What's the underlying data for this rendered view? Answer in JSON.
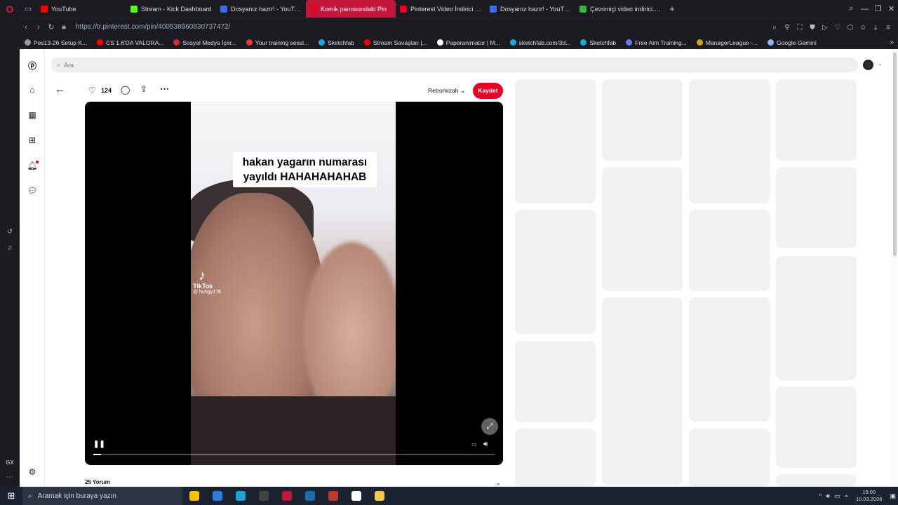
{
  "browser": {
    "tabs": [
      {
        "title": "YouTube",
        "color": "#ff0000",
        "active": false
      },
      {
        "title": "Stream - Kick Dashboard",
        "color": "#53fc18",
        "active": false
      },
      {
        "title": "Dosyanız hazır! - YouTube",
        "color": "#3a6ee8",
        "active": false
      },
      {
        "title": "Komik panosundaki Pin",
        "color": "#e60023",
        "active": true
      },
      {
        "title": "Pinterest Video İndirici - H",
        "color": "#e60023",
        "active": false
      },
      {
        "title": "Dosyanız hazır! - YouTube",
        "color": "#3a6ee8",
        "active": false
      },
      {
        "title": "Çevrimiçi video indirici. Ücr",
        "color": "#3cb043",
        "active": false
      }
    ],
    "new_tab": "+",
    "url": "https://tr.pinterest.com/pin/400538960830737472/",
    "bookmarks": [
      {
        "label": "Pes13-26 Setup K...",
        "color": "#999"
      },
      {
        "label": "CS 1.6'DA VALORA...",
        "color": "#ff0000"
      },
      {
        "label": "Sosyal Medya İçer...",
        "color": "#d32f2f"
      },
      {
        "label": "Your training sessi...",
        "color": "#e53935"
      },
      {
        "label": "Sketchfab",
        "color": "#1caad9"
      },
      {
        "label": "Stream Savaşları |...",
        "color": "#ff0000"
      },
      {
        "label": "Paperanimator | M...",
        "color": "#ffffff"
      },
      {
        "label": "sketchfab.com/3d...",
        "color": "#1caad9"
      },
      {
        "label": "Sketchfab",
        "color": "#1caad9"
      },
      {
        "label": "Free Aim Training...",
        "color": "#5c7cfa"
      },
      {
        "label": "ManagerLeague -...",
        "color": "#d4a017"
      },
      {
        "label": "Google Gemini",
        "color": "#8ab4f8"
      }
    ]
  },
  "search": {
    "placeholder": "Ara"
  },
  "pin": {
    "like_count": "124",
    "board_name": "Retromizah",
    "save_label": "Kaydet",
    "video_caption_line1": "hakan yagarın numarası",
    "video_caption_line2": "yayıldı HAHAHAHAHAB",
    "watermark_brand": "TikTok",
    "watermark_handle": "@ huhgy178",
    "progress": 0.02,
    "comments_label": "25 Yorum"
  },
  "taskbar": {
    "search_placeholder": "Aramak için buraya yazın",
    "time": "15:00",
    "date": "10.03.2026",
    "apps": [
      {
        "name": "store",
        "color": "#f4c20d"
      },
      {
        "name": "mail",
        "color": "#2a7de1"
      },
      {
        "name": "edge",
        "color": "#1fa2d8"
      },
      {
        "name": "mm",
        "color": "#444"
      },
      {
        "name": "opera",
        "color": "#c0173b"
      },
      {
        "name": "steam",
        "color": "#1b6cb0"
      },
      {
        "name": "chess",
        "color": "#c0392b"
      },
      {
        "name": "capcut",
        "color": "#ffffff"
      },
      {
        "name": "explorer",
        "color": "#f2c94c"
      }
    ]
  }
}
